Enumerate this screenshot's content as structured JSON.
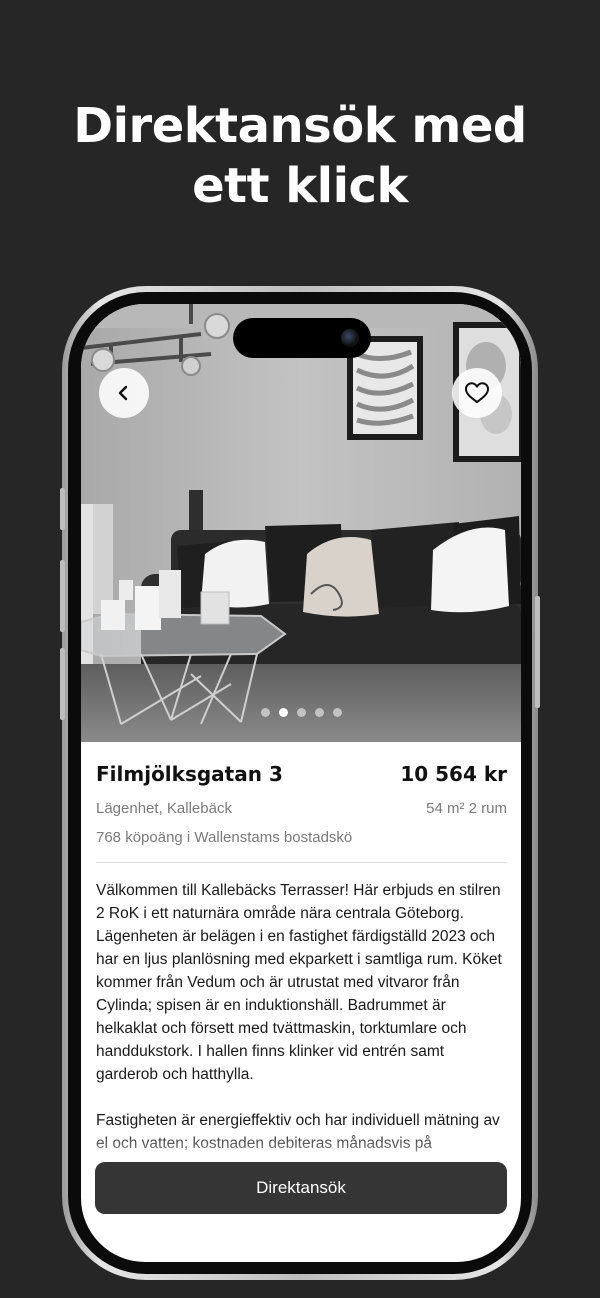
{
  "headline": [
    "Direktansök med",
    "ett klick"
  ],
  "photo": {
    "dot_count": 5,
    "active_dot": 1
  },
  "listing": {
    "address": "Filmjölksgatan 3",
    "price": "10 564 kr",
    "type_area": "Lägenhet, Kallebäck",
    "size_rooms": "54 m² 2 rum",
    "queue_points": "768 köpoäng i Wallenstams bostadskö",
    "description": [
      "Välkommen till Kallebäcks Terrasser! Här erbjuds en stilren 2 RoK i ett naturnära område nära centrala Göteborg. Lägenheten är belägen i en fastighet färdigställd 2023 och har en ljus planlösning med ekparkett i samtliga rum. Köket kommer från Vedum och är utrustat med vitvaror från Cylinda; spisen är en induktionshäll. Badrummet är helkaklat och försett med tvättmaskin, torktumlare och handdukstork. I hallen finns klinker vid entrén samt garderob och hatthylla.",
      "Fastigheten är energieffektiv och har individuell mätning av el och vatten; kostnaden debiteras månadsvis på"
    ]
  },
  "actions": {
    "apply_label": "Direktansök"
  },
  "icons": {
    "back": "chevron-left-icon",
    "favorite": "heart-icon"
  },
  "colors": {
    "background": "#262626",
    "button": "#353535",
    "muted_text": "#7a7a7a"
  }
}
